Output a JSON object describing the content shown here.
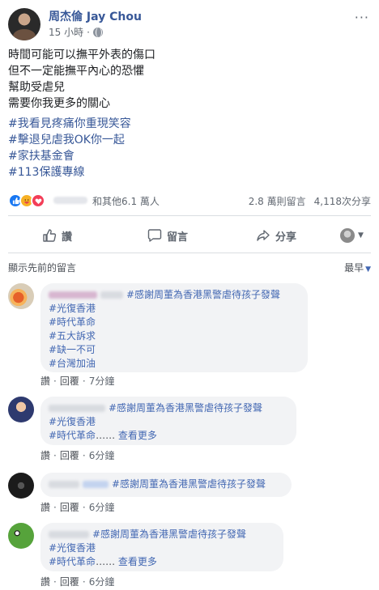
{
  "post": {
    "author": "周杰倫 Jay Chou",
    "time": "15 小時",
    "time_sep": "·",
    "more": "···",
    "lines": [
      "時間可能可以撫平外表的傷口",
      "但不一定能撫平內心的恐懼",
      "幫助受虐兒",
      "需要你我更多的關心"
    ],
    "hashtags": [
      "#我看見疼痛你重現笑容",
      "#擊退兒虐我OK你一起",
      "#家扶基金會",
      "#113保護專線"
    ]
  },
  "reactions": {
    "icons": [
      "like-icon",
      "care-icon",
      "love-icon"
    ],
    "others": "和其他6.1 萬人",
    "comments": "2.8 萬則留言",
    "shares": "4,118次分享"
  },
  "actions": {
    "like": "讚",
    "comment": "留言",
    "share": "分享"
  },
  "comments_header": {
    "previous": "顯示先前的留言",
    "sort": "最早"
  },
  "comments": [
    {
      "head": "#感謝周董為香港黑警虐待孩子發聲",
      "lines": [
        "#光復香港",
        "#時代革命",
        "#五大訴求",
        "#缺一不可",
        "#台灣加油"
      ],
      "like": "讚",
      "reply": "回覆",
      "time": "7分鐘"
    },
    {
      "head": "#感謝周董為香港黑警虐待孩子發聲",
      "lines": [
        "#光復香港",
        "#時代革命"
      ],
      "ellipsis": "……",
      "see_more": "查看更多",
      "like": "讚",
      "reply": "回覆",
      "time": "6分鐘"
    },
    {
      "head": "#感謝周董為香港黑警虐待孩子發聲",
      "like": "讚",
      "reply": "回覆",
      "time": "6分鐘"
    },
    {
      "head": "#感謝周董為香港黑警虐待孩子發聲",
      "lines": [
        "#光復香港",
        "#時代革命"
      ],
      "ellipsis": "……",
      "see_more": "查看更多",
      "like": "讚",
      "reply": "回覆",
      "time": "6分鐘"
    }
  ],
  "colors": {
    "link": "#385898",
    "bubble": "#f2f3f5",
    "meta": "#606770"
  }
}
